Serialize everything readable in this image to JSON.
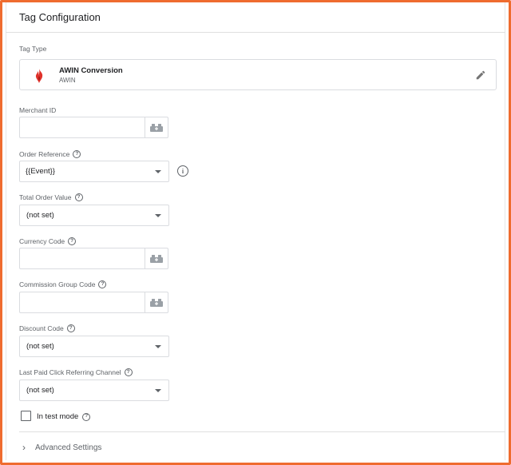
{
  "header": {
    "title": "Tag Configuration"
  },
  "tag_type": {
    "label": "Tag Type",
    "name": "AWIN Conversion",
    "vendor": "AWIN",
    "logo_color": "#e0322b",
    "edit_icon": "pencil-icon"
  },
  "fields": {
    "merchant_id": {
      "label": "Merchant ID",
      "value": ""
    },
    "order_reference": {
      "label": "Order Reference",
      "value": "{{Event}}"
    },
    "total_order_value": {
      "label": "Total Order Value",
      "value": "(not set)"
    },
    "currency_code": {
      "label": "Currency Code",
      "value": ""
    },
    "commission_group_code": {
      "label": "Commission Group Code",
      "value": ""
    },
    "discount_code": {
      "label": "Discount Code",
      "value": "(not set)"
    },
    "last_paid_click": {
      "label": "Last Paid Click Referring Channel",
      "value": "(not set)"
    }
  },
  "test_mode": {
    "label": "In test mode",
    "checked": false
  },
  "advanced": {
    "label": "Advanced Settings"
  },
  "colors": {
    "accent_border": "#ef6c2f",
    "text": "#202124",
    "muted": "#5f6368"
  }
}
